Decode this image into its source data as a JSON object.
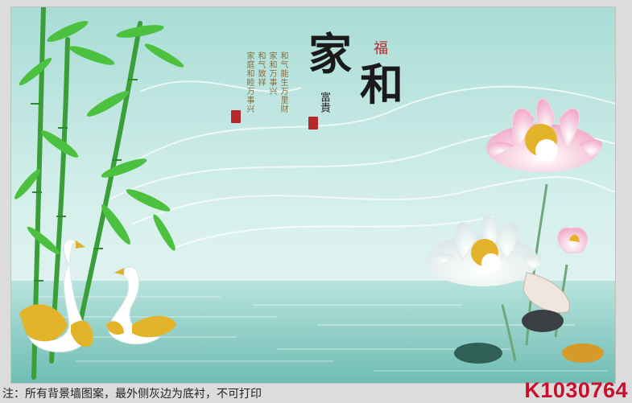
{
  "artwork": {
    "family_title_1": "家",
    "family_title_2": "和",
    "fu_character": "福",
    "fugui_text": "富貴",
    "poem_lines": [
      "和气能生万里财",
      "家和万事兴",
      "和气致祥",
      "家庭和睦万事兴"
    ],
    "colors": {
      "sky": "#bfe6e1",
      "water": "#93cfc8",
      "bamboo": "#3fae3a",
      "lotus_pink": "#f3c6d8",
      "gold": "#e3b32a"
    }
  },
  "footer": {
    "note": "注：所有背景墙图案，最外侧灰边为底衬，不可打印",
    "product_code": "K1030764"
  }
}
